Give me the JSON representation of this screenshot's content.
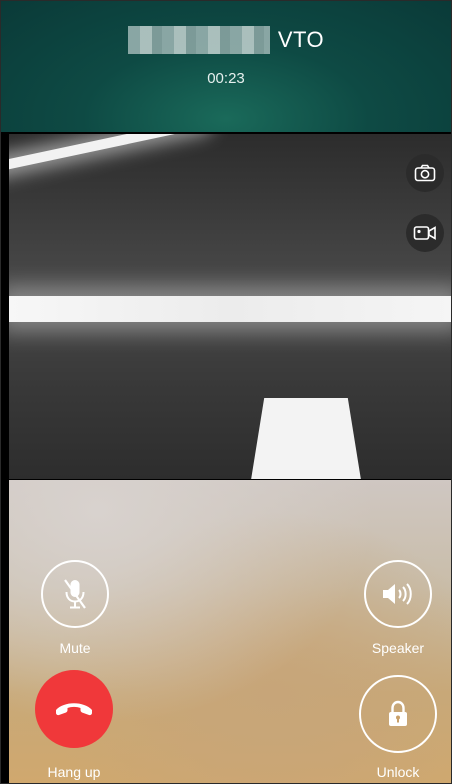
{
  "header": {
    "callee_label": "VTO",
    "timer": "00:23"
  },
  "video_controls": {
    "snapshot_icon": "camera-icon",
    "record_icon": "video-record-icon"
  },
  "controls": {
    "mute_label": "Mute",
    "speaker_label": "Speaker",
    "hangup_label": "Hang up",
    "unlock_label": "Unlock"
  },
  "colors": {
    "header": "#0e4a44",
    "hangup": "#f0383a"
  }
}
